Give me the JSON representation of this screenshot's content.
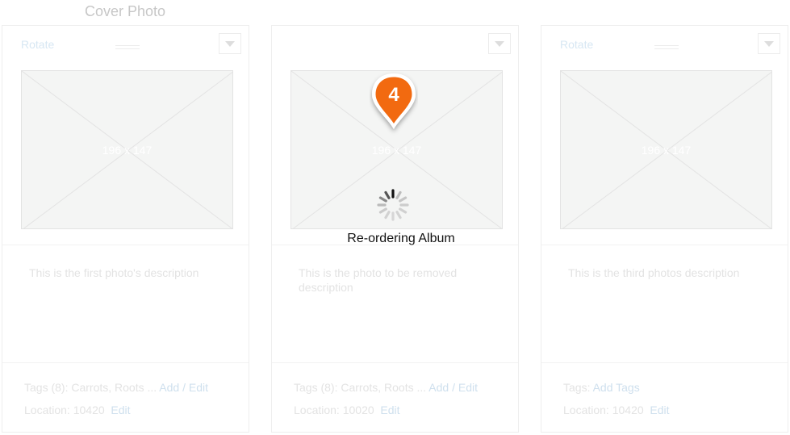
{
  "cover_photo_label": "Cover Photo",
  "cards": [
    {
      "rotate": "Rotate",
      "dims": "196 x 147",
      "description": "This is the first photo's description",
      "tags_prefix": "Tags (8): Carrots, Roots ...",
      "tags_link": "Add / Edit",
      "location": "Location: 10420",
      "location_link": "Edit"
    },
    {
      "rotate": "",
      "dims": "196 x 147",
      "description": "This is the photo to be removed description",
      "tags_prefix": "Tags (8): Carrots, Roots ...",
      "tags_link": "Add / Edit",
      "location": "Location: 10020",
      "location_link": "Edit"
    },
    {
      "rotate": "Rotate",
      "dims": "196 x 147",
      "description": "This is the third photos description",
      "tags_prefix": "Tags:",
      "tags_link": "Add Tags",
      "location": "Location: 10420",
      "location_link": "Edit"
    }
  ],
  "overlay": {
    "status": "Re-ordering Album",
    "marker_number": "4",
    "marker_color": "#f26a10"
  },
  "colors": {
    "link": "#cfe0ee",
    "muted_text": "#e3e3e3"
  }
}
